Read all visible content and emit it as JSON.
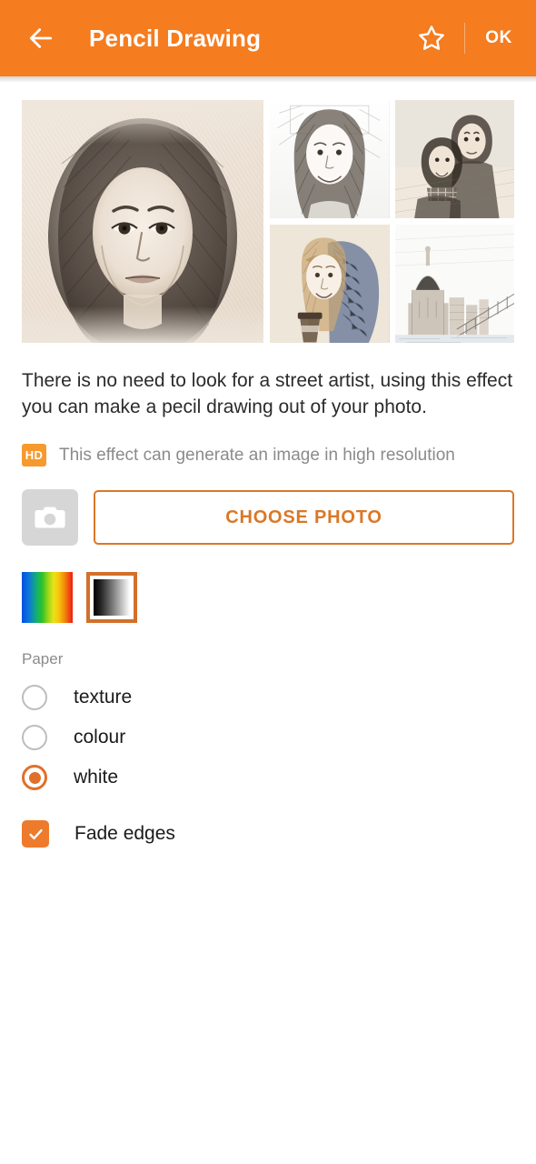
{
  "appbar": {
    "back_icon": "arrow-left-icon",
    "title": "Pencil Drawing",
    "favorite_icon": "star-outline-icon",
    "ok_label": "OK",
    "background_color": "#F57C1F",
    "text_color": "#FFFFFF"
  },
  "gallery": {
    "items": [
      {
        "name": "woman-portrait-large",
        "caption": "Pencil sketch portrait of a woman with long dark hair"
      },
      {
        "name": "smiling-woman-small",
        "caption": "Pencil sketch of a smiling young woman"
      },
      {
        "name": "couple-embracing",
        "caption": "Pencil sketch of a couple embracing outdoors"
      },
      {
        "name": "blonde-woman-scarf",
        "caption": "Pencil sketch of a blonde woman in a knitted scarf holding coffee"
      },
      {
        "name": "city-skyline-bridge",
        "caption": "Pencil sketch of a city skyline with cathedral dome and bridge"
      }
    ]
  },
  "description": {
    "text": "There is no need to look for a street artist, using this effect you can make a pecil drawing out of your photo."
  },
  "hd_notice": {
    "badge": "HD",
    "badge_color": "#F59A2E",
    "text": "This effect can generate an image in high resolution"
  },
  "photo_row": {
    "camera_icon": "camera-icon",
    "choose_label": "CHOOSE PHOTO",
    "accent_color": "#DB7726"
  },
  "swatches": {
    "items": [
      {
        "name": "colour-gradient-swatch",
        "label": "colour",
        "selected": false
      },
      {
        "name": "grayscale-gradient-swatch",
        "label": "grayscale",
        "selected": true
      }
    ],
    "selected_border_color": "#D2702A"
  },
  "paper": {
    "label": "Paper",
    "options": [
      {
        "label": "texture",
        "selected": false
      },
      {
        "label": "colour",
        "selected": false
      },
      {
        "label": "white",
        "selected": true
      }
    ],
    "selected_color": "#E0702A"
  },
  "fade_edges": {
    "label": "Fade edges",
    "checked": true,
    "color": "#EE7B2C",
    "check_icon": "checkmark-icon"
  }
}
